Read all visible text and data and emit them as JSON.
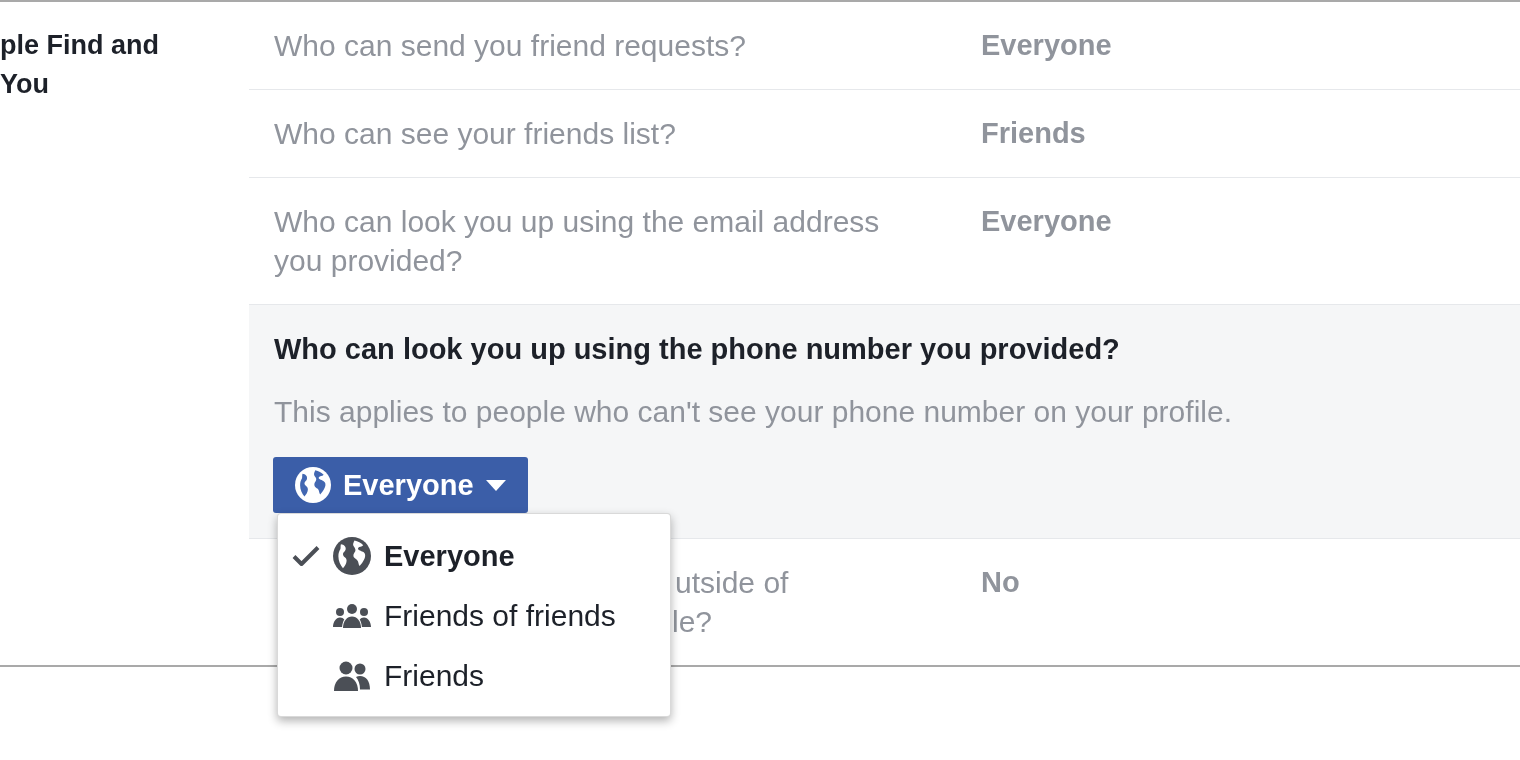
{
  "section": {
    "title": "ple Find and You"
  },
  "settings": [
    {
      "question": "Who can send you friend requests?",
      "value": "Everyone",
      "expanded": false
    },
    {
      "question": "Who can see your friends list?",
      "value": "Friends",
      "expanded": false
    },
    {
      "question": "Who can look you up using the email address you provided?",
      "value": "Everyone",
      "expanded": false
    },
    {
      "question": "Who can look you up using the phone number you provided?",
      "description": "This applies to people who can't see your phone number on your profile.",
      "expanded": true,
      "dropdown": {
        "label": "Everyone",
        "kind": "public",
        "open": true,
        "options": [
          {
            "label": "Everyone",
            "kind": "public",
            "selected": true
          },
          {
            "label": "Friends of friends",
            "kind": "extended",
            "selected": false
          },
          {
            "label": "Friends",
            "kind": "friends",
            "selected": false
          }
        ]
      }
    },
    {
      "question_parts": [
        "utside of",
        "le?"
      ],
      "value": "No",
      "expanded": false
    }
  ]
}
